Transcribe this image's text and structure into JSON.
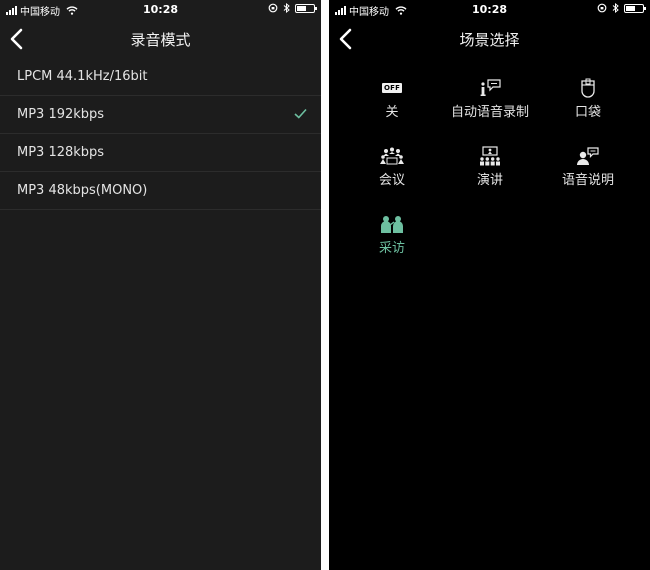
{
  "status_bar": {
    "carrier": "中国移动",
    "time": "10:28",
    "battery_level": 0.55
  },
  "left_screen": {
    "title": "录音模式",
    "modes": [
      {
        "label": "LPCM 44.1kHz/16bit",
        "selected": false
      },
      {
        "label": "MP3 192kbps",
        "selected": true
      },
      {
        "label": "MP3 128kbps",
        "selected": false
      },
      {
        "label": "MP3 48kbps(MONO)",
        "selected": false
      }
    ]
  },
  "right_screen": {
    "title": "场景选择",
    "off_icon_text": "OFF",
    "scenes": [
      {
        "label": "关",
        "icon": "off-icon"
      },
      {
        "label": "自动语音录制",
        "icon": "info-speech-icon"
      },
      {
        "label": "口袋",
        "icon": "pocket-icon"
      },
      {
        "label": "会议",
        "icon": "meeting-icon"
      },
      {
        "label": "演讲",
        "icon": "lecture-icon"
      },
      {
        "label": "语音说明",
        "icon": "voice-memo-icon"
      },
      {
        "label": "采访",
        "icon": "interview-icon",
        "active": true
      }
    ]
  },
  "colors": {
    "accent": "#6dbfa0",
    "left_bg": "#1c1c1c",
    "right_bg": "#000000"
  }
}
